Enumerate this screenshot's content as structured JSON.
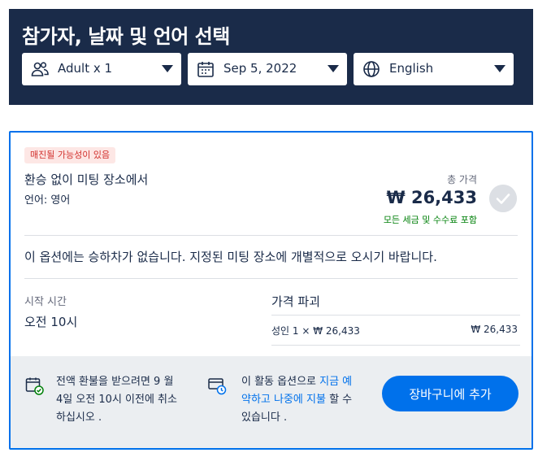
{
  "header": {
    "title": "참가자, 날짜 및 언어 선택",
    "participants": {
      "label": "Adult x 1",
      "icon": "people-icon"
    },
    "date": {
      "label": "Sep 5, 2022",
      "icon": "calendar-icon"
    },
    "language": {
      "label": "English",
      "icon": "globe-icon"
    }
  },
  "option": {
    "badge": "매진될 가능성이 있음",
    "title": "환승 없이 미팅 장소에서",
    "language_line": "언어: 영어",
    "total_label": "총 가격",
    "total_price": "₩ 26,433",
    "total_note": "모든 세금 및 수수료 포함",
    "description": "이 옵션에는 승하차가 없습니다. 지정된 미팅 장소에 개별적으로 오시기 바랍니다.",
    "start_time_label": "시작 시간",
    "start_time_value": "오전 10시",
    "breakdown_title": "가격 파괴",
    "breakdown_row_label": "성인 1 × ₩ 26,433",
    "breakdown_row_value": "₩ 26,433"
  },
  "footer": {
    "refund_line1": "전액 환불을 받으려면 9 월",
    "refund_line2": "4일 오전 10시 이전에 취소",
    "refund_line3": "하십시오 .",
    "reserve_pre": "이 활동 옵션으로 ",
    "reserve_link1": "지금 예",
    "reserve_link2": "약하고 나중에 지불",
    "reserve_post": " 할 수",
    "reserve_line3": "있습니다 .",
    "cart_button": "장바구니에 추가"
  },
  "colors": {
    "header_bg": "#1a2b49",
    "accent": "#0071eb",
    "badge_text": "#d2312d",
    "included_text": "#008009"
  }
}
